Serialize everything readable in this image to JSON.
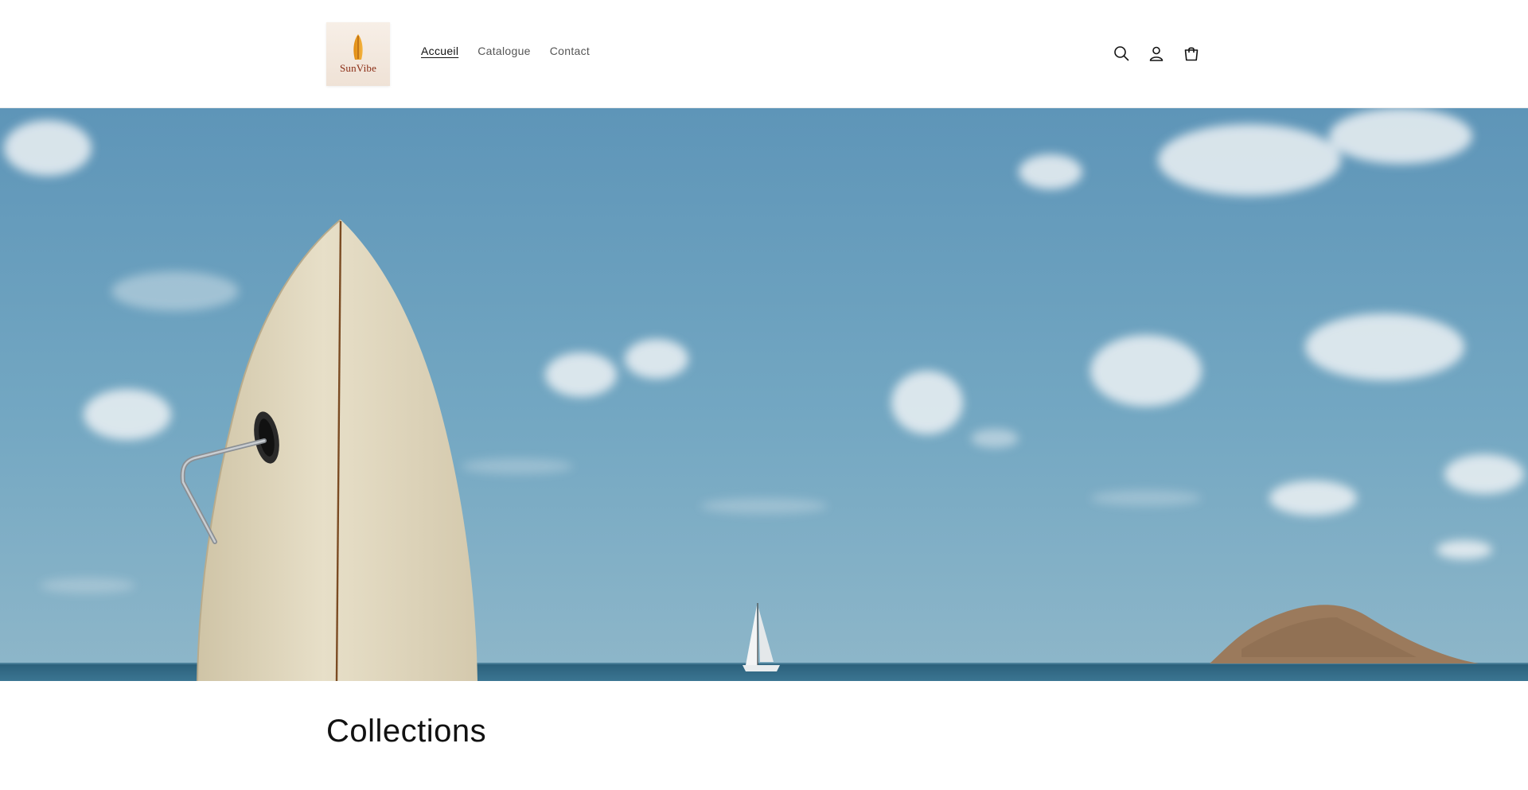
{
  "brand": {
    "name": "SunVibe",
    "logo_icon": "surfboard-icon",
    "accent_color": "#8a2c14"
  },
  "nav": {
    "items": [
      {
        "label": "Accueil",
        "active": true
      },
      {
        "label": "Catalogue",
        "active": false
      },
      {
        "label": "Contact",
        "active": false
      }
    ]
  },
  "header_icons": [
    "search-icon",
    "account-icon",
    "cart-icon"
  ],
  "hero": {
    "image": "surfboard-on-beach-with-sailboat-and-island",
    "sky_color": "#6a9fbd",
    "sea_color": "#2e6580"
  },
  "collections": {
    "title": "Collections"
  }
}
